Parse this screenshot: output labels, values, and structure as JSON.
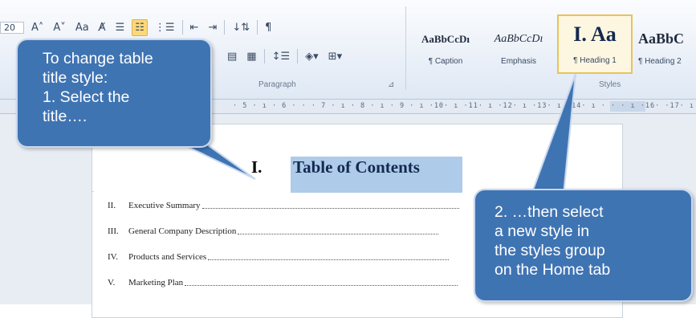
{
  "ribbon": {
    "font_size_value": "20",
    "paragraph_group_label": "Paragraph",
    "styles_group_label": "Styles",
    "styles": [
      {
        "sample": "AaBbCcDı",
        "name": "¶ Caption"
      },
      {
        "sample": "AaBbCcDı",
        "name": "Emphasis"
      },
      {
        "sample": "I.  Aa",
        "name": "¶ Heading 1"
      },
      {
        "sample": "AaBbC",
        "name": "¶ Heading 2"
      }
    ]
  },
  "ruler": {
    "text": "· 5 · ı · 6 · · · 7 · ı · 8 · ı · 9 · ı ·10· ı ·11· ı ·12· ı ·13· ı ·14· ı · · · ı ·16·  ·17· ı ·18· ı"
  },
  "document": {
    "title_number": "I.",
    "title_text": "Table of Contents",
    "toc": [
      {
        "num": "II.",
        "text": "Executive Summary"
      },
      {
        "num": "III.",
        "text": "General Company Description"
      },
      {
        "num": "IV.",
        "text": "Products and Services"
      },
      {
        "num": "V.",
        "text": "Marketing Plan"
      }
    ]
  },
  "callouts": {
    "left": [
      "To change table",
      "title style:",
      "1. Select the",
      "title…."
    ],
    "right": [
      "2. …then select",
      "a new style in",
      "the styles group",
      "on the Home tab"
    ]
  }
}
